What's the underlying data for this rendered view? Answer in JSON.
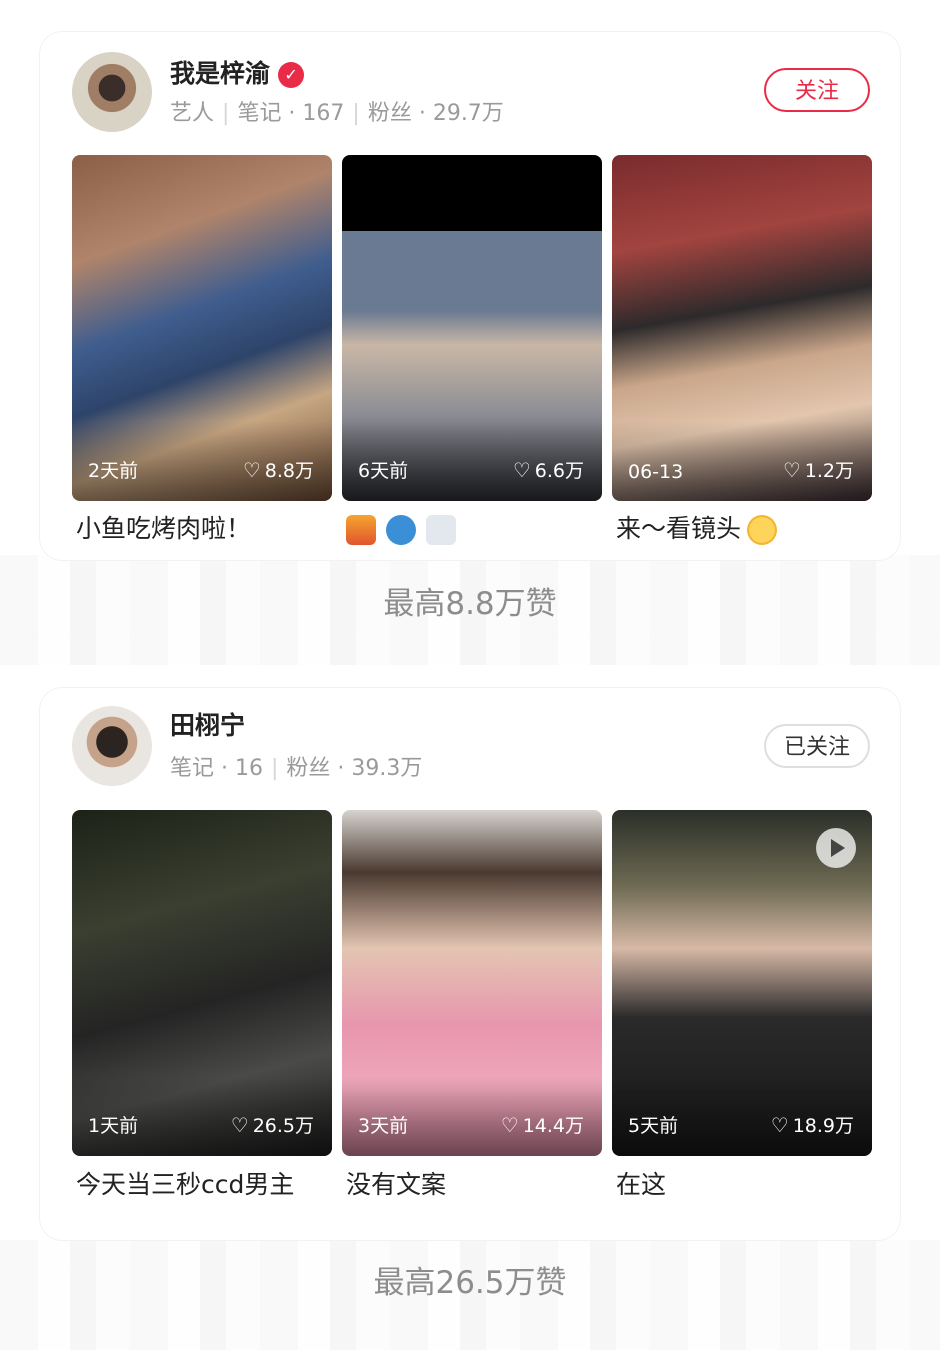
{
  "cards": [
    {
      "name": "我是梓渝",
      "verified": true,
      "meta": [
        "艺人",
        "笔记 · 167",
        "粉丝 · 29.7万"
      ],
      "button": "关注",
      "posts": [
        {
          "date": "2天前",
          "likes": "8.8万",
          "caption": "小鱼吃烤肉啦！"
        },
        {
          "date": "6天前",
          "likes": "6.6万",
          "caption": ""
        },
        {
          "date": "06-13",
          "likes": "1.2万",
          "caption": "来～看镜头"
        }
      ],
      "summary": "最高8.8万赞"
    },
    {
      "name": "田栩宁",
      "verified": false,
      "meta": [
        "笔记 · 16",
        "粉丝 · 39.3万"
      ],
      "button": "已关注",
      "posts": [
        {
          "date": "1天前",
          "likes": "26.5万",
          "caption": "今天当三秒ccd男主"
        },
        {
          "date": "3天前",
          "likes": "14.4万",
          "caption": "没有文案"
        },
        {
          "date": "5天前",
          "likes": "18.9万",
          "caption": "在这"
        }
      ],
      "summary": "最高26.5万赞"
    }
  ],
  "icons": {
    "verified": "verified-badge-icon",
    "heart": "heart-outline-icon",
    "play": "play-icon",
    "emoji_city": "city-sunset-emoji",
    "emoji_fish": "fish-emoji",
    "emoji_wind": "wind-emoji",
    "emoji_hug": "hugging-face-emoji"
  },
  "colors": {
    "accent": "#ea2b48",
    "meta_text": "#9a9a9a",
    "summary_text": "#8d8d8d"
  }
}
